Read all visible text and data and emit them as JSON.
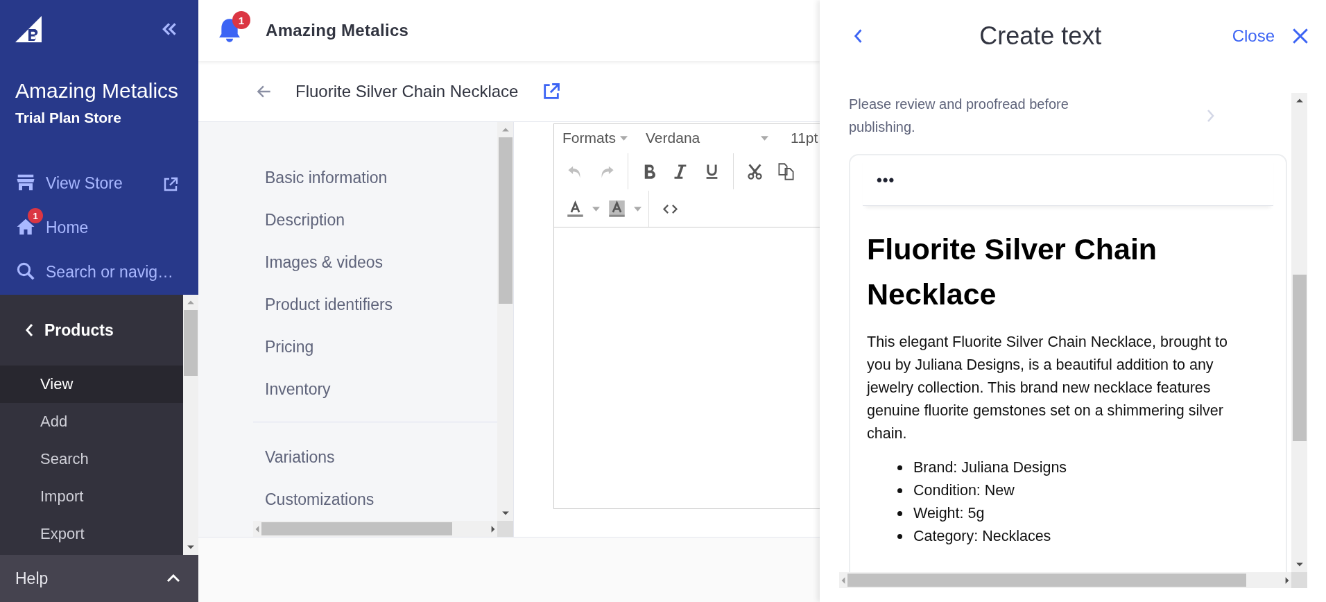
{
  "sidebar": {
    "store_name": "Amazing Metalics",
    "store_plan": "Trial Plan Store",
    "links": [
      {
        "kind": "view_store",
        "label": "View Store"
      },
      {
        "kind": "home",
        "label": "Home",
        "badge": "1"
      },
      {
        "kind": "search",
        "label": "Search or navig…"
      }
    ],
    "section": "Products",
    "items": [
      {
        "label": "View",
        "selected": true
      },
      {
        "label": "Add",
        "selected": false
      },
      {
        "label": "Search",
        "selected": false
      },
      {
        "label": "Import",
        "selected": false
      },
      {
        "label": "Export",
        "selected": false
      }
    ],
    "help": "Help"
  },
  "topbar": {
    "notification_badge": "1",
    "store_name": "Amazing Metalics"
  },
  "product": {
    "title": "Fluorite Silver Chain Necklace"
  },
  "nav": {
    "sections": [
      {
        "items": [
          {
            "label": "Basic information"
          },
          {
            "label": "Description"
          },
          {
            "label": "Images & videos"
          },
          {
            "label": "Product identifiers"
          },
          {
            "label": "Pricing"
          },
          {
            "label": "Inventory"
          }
        ]
      },
      {
        "items": [
          {
            "label": "Variations"
          },
          {
            "label": "Customizations"
          }
        ]
      }
    ]
  },
  "editor": {
    "formats": "Formats",
    "font": "Verdana",
    "size": "11pt",
    "row_1": [
      {
        "kind": "undo",
        "disabled": true
      },
      {
        "kind": "redo",
        "disabled": true
      },
      {
        "kind": "bold",
        "disabled": false
      },
      {
        "kind": "italic",
        "disabled": false
      },
      {
        "kind": "underline",
        "disabled": false
      },
      {
        "kind": "cut",
        "disabled": false
      },
      {
        "kind": "copy",
        "disabled": false
      }
    ],
    "row_2": [
      {
        "kind": "text_color",
        "disabled": false
      },
      {
        "kind": "highlight",
        "disabled": false
      },
      {
        "kind": "code",
        "disabled": false
      }
    ]
  },
  "panel": {
    "title": "Create text",
    "close": "Close",
    "notice": "Please review and proofread before publishing.",
    "card": {
      "menu": "•••",
      "heading": "Fluorite Silver Chain Necklace",
      "paragraph": "This elegant Fluorite Silver Chain Necklace, brought to you by Juliana Designs, is a beautiful addition to any jewelry collection. This brand new necklace features genuine fluorite gemstones set on a shimmering silver chain.",
      "bullets": [
        "Brand: Juliana Designs",
        "Condition: New",
        "Weight: 5g",
        "Category: Necklaces"
      ]
    }
  }
}
